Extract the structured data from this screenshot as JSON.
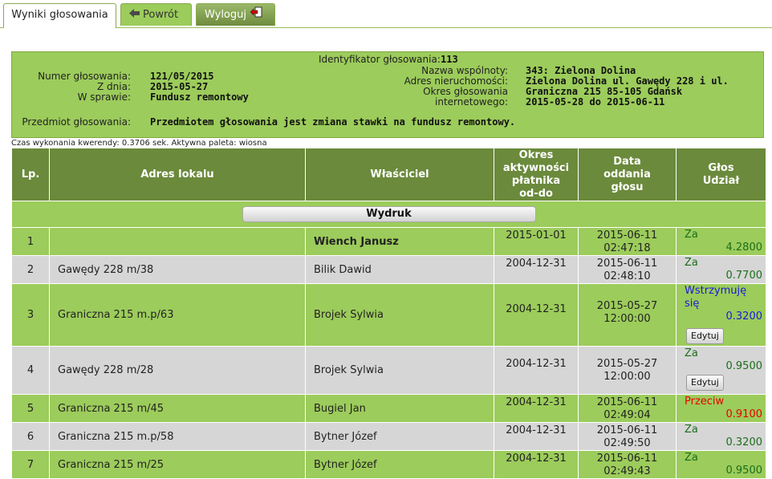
{
  "tabs": {
    "results": "Wyniki głosowania",
    "back": "Powrót",
    "logout": "Wyloguj"
  },
  "info": {
    "id_label": "Identyfikator głosowania:",
    "id_value": "113",
    "number_label": "Numer głosowania:",
    "number_value": "121/05/2015",
    "date_label": "Z dnia:",
    "date_value": "2015-05-27",
    "matter_label": "W sprawie:",
    "matter_value": "Fundusz remontowy",
    "community_label": "Nazwa wspólnoty:",
    "community_value": "343: Zielona Dolina",
    "address_label": "Adres nieruchomości:",
    "address_value_1": "Zielona Dolina ul. Gawędy 228 i ul.",
    "address_value_2": "Graniczna 215 85-105 Gdańsk",
    "period_label_1": "Okres głosowania",
    "period_label_2": "internetowego:",
    "period_value": "2015-05-28 do 2015-06-11",
    "subject_label": "Przedmiot głosowania:",
    "subject_value": "Przedmiotem głosowania jest zmiana stawki na fundusz remontowy."
  },
  "status": "Czas wykonania kwerendy: 0.3706 sek.   Aktywna paleta: wiosna",
  "table": {
    "headers": {
      "lp": "Lp.",
      "address": "Adres lokalu",
      "owner": "Właściciel",
      "period_1": "Okres",
      "period_2": "aktywności",
      "period_3": "płatnika",
      "period_4": "od-do",
      "date_1": "Data",
      "date_2": "oddania",
      "date_3": "głosu",
      "vote_1": "Głos",
      "vote_2": "Udział"
    },
    "print_label": "Wydruk",
    "edit_label": "Edytuj",
    "rows": [
      {
        "lp": "1",
        "address": "",
        "owner": "Wiench Janusz",
        "period": "2015-01-01",
        "date": "2015-06-11",
        "time": "02:47:18",
        "vote": "Za",
        "share": "4.2800"
      },
      {
        "lp": "2",
        "address": "Gawędy 228 m/38",
        "owner": "Bilik Dawid",
        "period": "2004-12-31",
        "date": "2015-06-11",
        "time": "02:48:10",
        "vote": "Za",
        "share": "0.7700"
      },
      {
        "lp": "3",
        "address": "Graniczna 215 m.p/63",
        "owner": "Brojek Sylwia",
        "period": "2004-12-31",
        "date": "2015-05-27",
        "time": "12:00:00",
        "vote": "Wstrzymuję się",
        "share": "0.3200"
      },
      {
        "lp": "4",
        "address": "Gawędy 228 m/28",
        "owner": "Brojek Sylwia",
        "period": "2004-12-31",
        "date": "2015-05-27",
        "time": "12:00:00",
        "vote": "Za",
        "share": "0.9500"
      },
      {
        "lp": "5",
        "address": "Graniczna 215 m/45",
        "owner": "Bugiel Jan",
        "period": "2004-12-31",
        "date": "2015-06-11",
        "time": "02:49:04",
        "vote": "Przeciw",
        "share": "0.9100"
      },
      {
        "lp": "6",
        "address": "Graniczna 215 m.p/58",
        "owner": "Bytner Józef",
        "period": "2004-12-31",
        "date": "2015-06-11",
        "time": "02:49:50",
        "vote": "Za",
        "share": "0.3200"
      },
      {
        "lp": "7",
        "address": "Graniczna 215 m/25",
        "owner": "Bytner Józef",
        "period": "2004-12-31",
        "date": "2015-06-11",
        "time": "02:49:43",
        "vote": "Za",
        "share": "0.9500"
      }
    ]
  }
}
